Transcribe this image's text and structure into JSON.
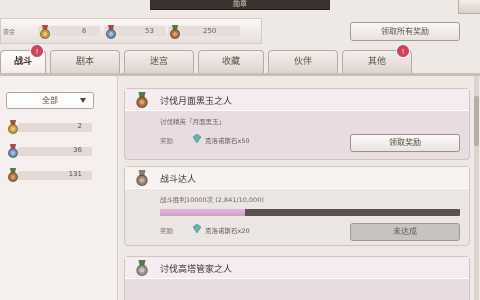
{
  "window": {
    "title": "勋章"
  },
  "stats": {
    "label": "鎏金",
    "items": [
      {
        "icon": "medal-gold-icon",
        "value": "6"
      },
      {
        "icon": "medal-blue-icon",
        "value": "53"
      },
      {
        "icon": "medal-bronze-icon",
        "value": "250"
      }
    ]
  },
  "claim_all_label": "领取所有奖励",
  "tabs": [
    {
      "label": "战斗",
      "active": true,
      "badge": "!"
    },
    {
      "label": "剧本",
      "active": false
    },
    {
      "label": "迷宫",
      "active": false
    },
    {
      "label": "收藏",
      "active": false
    },
    {
      "label": "伙伴",
      "active": false
    },
    {
      "label": "其他",
      "active": false,
      "badge": "!"
    }
  ],
  "filter": {
    "selected": "全部"
  },
  "left_counts": [
    {
      "icon": "medal-gold-icon",
      "value": "2"
    },
    {
      "icon": "medal-blue-icon",
      "value": "36"
    },
    {
      "icon": "medal-bronze-icon",
      "value": "131"
    }
  ],
  "achievements": [
    {
      "title": "讨伐月面黑玉之人",
      "description": "讨伐精英「月面黑玉」",
      "reward_label": "奖励",
      "reward": "克洛诺斯石x50",
      "button": "领取奖励",
      "state": "claimable"
    },
    {
      "title": "战斗达人",
      "description": "战斗胜利10000次 (2,841/10,000)",
      "progress": 0.2841,
      "reward_label": "奖励",
      "reward": "克洛诺斯石x20",
      "button": "未达成",
      "state": "locked"
    },
    {
      "title": "讨伐高塔管家之人",
      "description": "",
      "state": "claimable"
    }
  ],
  "colors": {
    "gold_medal": "#c89a3c",
    "blue_medal": "#6f8fb0",
    "bronze_medal": "#b0703e",
    "badge": "#d3415a",
    "progress_fill": "#caa1c3",
    "progress_track": "#5b5050"
  }
}
